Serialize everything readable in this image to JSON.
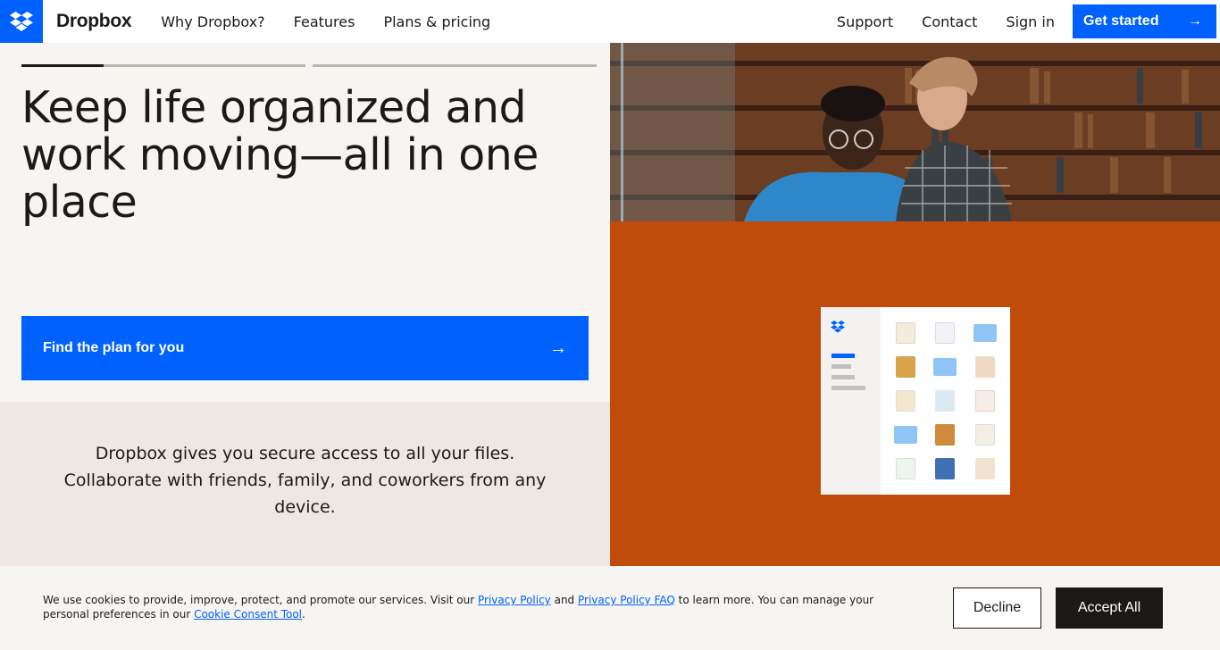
{
  "header": {
    "brand": "Dropbox",
    "nav_left": [
      "Why Dropbox?",
      "Features",
      "Plans & pricing"
    ],
    "nav_right": [
      "Support",
      "Contact",
      "Sign in"
    ],
    "cta_label": "Get started",
    "cta_icon": "arrow-right-icon",
    "logo_icon": "dropbox-logo-icon",
    "accent": "#0061fe"
  },
  "hero": {
    "progress": [
      0.29,
      0,
      0
    ],
    "headline": "Keep life organized and work moving—all in one place",
    "cta_label": "Find the plan for you",
    "subtext": "Dropbox gives you secure access to all your files. Collaborate with friends, family, and coworkers from any device.",
    "panel_color": "#c04b0b"
  },
  "cookie": {
    "text_1": "We use cookies to provide, improve, protect, and promote our services. Visit our ",
    "link_privacy": "Privacy Policy",
    "text_2": " and ",
    "link_faq": "Privacy Policy FAQ",
    "text_3": " to learn more. You can manage your personal preferences in our ",
    "link_tool": "Cookie Consent Tool",
    "text_4": ".",
    "decline_label": "Decline",
    "accept_label": "Accept All"
  }
}
